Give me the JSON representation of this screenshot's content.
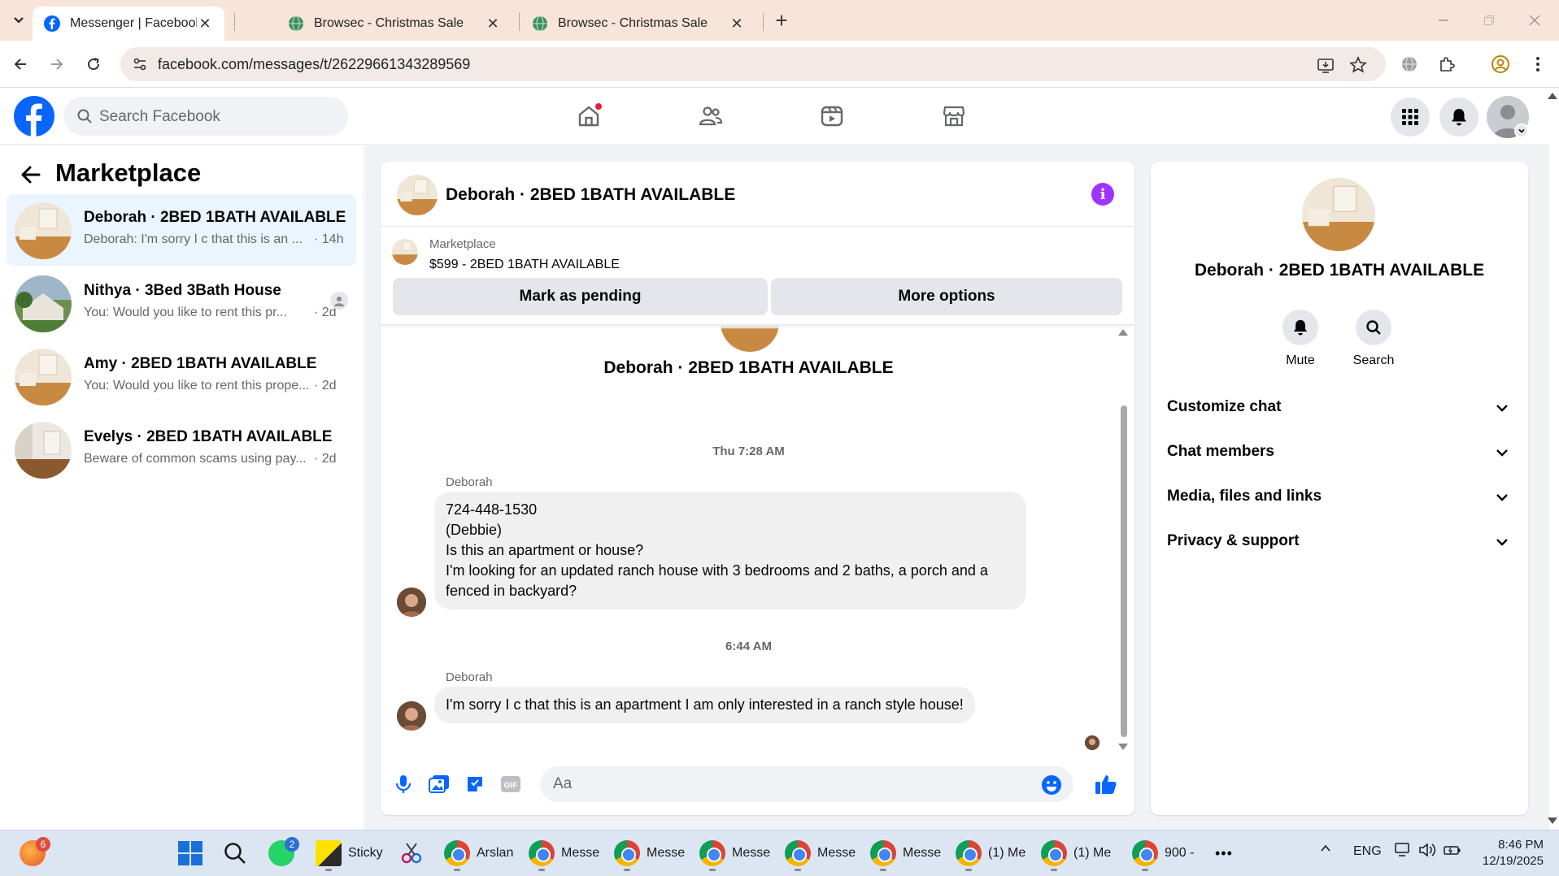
{
  "browser": {
    "tabs": [
      {
        "title": "Messenger | Facebook",
        "active": true
      },
      {
        "title": "Browsec - Christmas Sale",
        "active": false
      },
      {
        "title": "Browsec - Christmas Sale",
        "active": false
      }
    ],
    "new_tab": "+",
    "url": "facebook.com/messages/t/26229661343289569",
    "close_glyph": "✕"
  },
  "fb": {
    "search_placeholder": "Search Facebook",
    "nav_icons": [
      "home-icon",
      "friends-icon",
      "watch-icon",
      "marketplace-icon"
    ],
    "right_icons": [
      "menu-grid-icon",
      "notifications-icon",
      "profile-icon"
    ]
  },
  "sidebar": {
    "title": "Marketplace",
    "conversations": [
      {
        "name": "Deborah · 2BED 1BATH AVAILABLE",
        "preview": "Deborah: I'm sorry I c that this is an ...",
        "time": "· 14h",
        "active": true
      },
      {
        "name": "Nithya · 3Bed 3Bath House",
        "preview": "You: Would you like to rent this pr...",
        "time": "· 2d",
        "active": false
      },
      {
        "name": "Amy · 2BED 1BATH AVAILABLE",
        "preview": "You: Would you like to rent this prope...",
        "time": "· 2d",
        "active": false
      },
      {
        "name": "Evelys · 2BED 1BATH AVAILABLE",
        "preview": "Beware of common scams using pay...",
        "time": "· 2d",
        "active": false
      }
    ]
  },
  "chat": {
    "title": "Deborah · 2BED 1BATH AVAILABLE",
    "marketplace_label": "Marketplace",
    "listing": "$599 - 2BED 1BATH AVAILABLE",
    "mark_pending": "Mark as pending",
    "more_options": "More options",
    "thread_name": "Deborah · 2BED 1BATH AVAILABLE",
    "timestamp1": "Thu 7:28 AM",
    "sender1": "Deborah",
    "message1_lines": [
      "724-448-1530",
      "(Debbie)",
      "Is this an apartment or house?",
      "I'm looking for an updated ranch house with 3 bedrooms and 2 baths, a porch and a",
      "fenced in backyard?"
    ],
    "timestamp2": "6:44 AM",
    "sender2": "Deborah",
    "message2": "I'm sorry I c that this is an apartment I am only interested in a ranch style house!",
    "composer_placeholder": "Aa",
    "composer_icons": [
      "microphone-icon",
      "photo-icon",
      "sticker-icon",
      "gif-icon",
      "emoji-icon",
      "like-icon"
    ],
    "gif_label": "GIF"
  },
  "info": {
    "name": "Deborah · 2BED 1BATH AVAILABLE",
    "actions": [
      {
        "label": "Mute",
        "icon": "bell-icon"
      },
      {
        "label": "Search",
        "icon": "search-icon"
      }
    ],
    "sections": [
      "Customize chat",
      "Chat members",
      "Media, files and links",
      "Privacy & support"
    ]
  },
  "taskbar": {
    "start_badge": "6",
    "whatsapp_badge": "2",
    "items": [
      {
        "label": "Sticky"
      },
      {
        "label": ""
      },
      {
        "label": "Arslan"
      },
      {
        "label": "Messe"
      },
      {
        "label": "Messe"
      },
      {
        "label": "Messe"
      },
      {
        "label": "Messe"
      },
      {
        "label": "Messe"
      },
      {
        "label": "(1) Me"
      },
      {
        "label": "(1) Me"
      },
      {
        "label": "900 -"
      }
    ],
    "more": "•••",
    "language": "ENG",
    "time": "8:46 PM",
    "date": "12/19/2025"
  },
  "colors": {
    "tabbar": "#f8e4d9",
    "fb_blue": "#0866ff",
    "active_conversation": "#ebf5ff",
    "info_accent": "#a033ff",
    "bubble": "#f0f0f0"
  }
}
